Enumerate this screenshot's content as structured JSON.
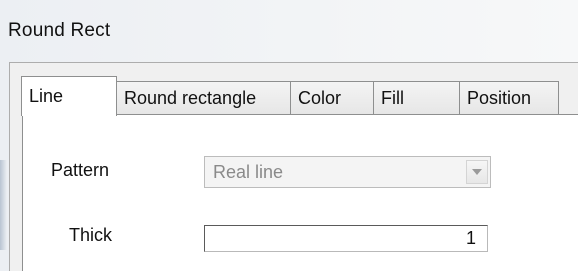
{
  "window": {
    "title": "Round Rect"
  },
  "tabs": [
    {
      "label": "Line",
      "active": true
    },
    {
      "label": "Round rectangle",
      "active": false
    },
    {
      "label": "Color",
      "active": false
    },
    {
      "label": "Fill",
      "active": false
    },
    {
      "label": "Position",
      "active": false
    }
  ],
  "line_panel": {
    "pattern_label": "Pattern",
    "pattern_value": "Real line",
    "pattern_disabled": true,
    "thick_label": "Thick",
    "thick_value": "1"
  },
  "icons": {
    "dropdown_arrow": "chevron-down-icon"
  },
  "colors": {
    "disabled_text": "#8a8a8a",
    "panel_bg": "#ffffff",
    "border": "#8e8f8f"
  }
}
